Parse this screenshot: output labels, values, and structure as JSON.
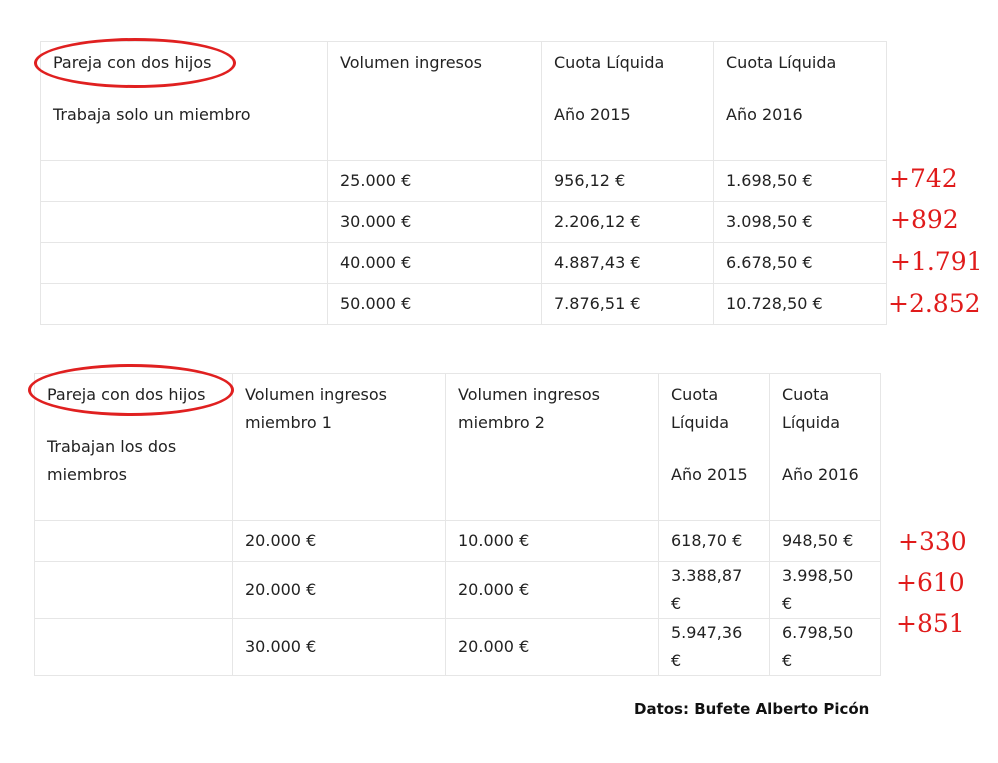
{
  "table1": {
    "header": {
      "title": "Pareja con dos hijos",
      "subtitle": "Trabaja solo un miembro",
      "income": "Volumen ingresos",
      "quota_label_2015": "Cuota Líquida",
      "year_2015": "Año 2015",
      "quota_label_2016": "Cuota Líquida",
      "year_2016": "Año 2016"
    },
    "rows": [
      {
        "income": "25.000 €",
        "q2015": "956,12 €",
        "q2016": "1.698,50 €",
        "delta": "+742"
      },
      {
        "income": "30.000 €",
        "q2015": "2.206,12 €",
        "q2016": "3.098,50 €",
        "delta": "+892"
      },
      {
        "income": "40.000 €",
        "q2015": "4.887,43 €",
        "q2016": "6.678,50 €",
        "delta": "+1.791"
      },
      {
        "income": "50.000 €",
        "q2015": "7.876,51 €",
        "q2016": "10.728,50 €",
        "delta": "+2.852"
      }
    ]
  },
  "table2": {
    "header": {
      "title": "Pareja con dos hijos",
      "subtitle_1": "Trabajan los dos",
      "subtitle_2": "miembros",
      "income1_a": "Volumen ingresos",
      "income1_b": "miembro 1",
      "income2_a": "Volumen ingresos",
      "income2_b": "miembro 2",
      "q2015_a": "Cuota",
      "q2015_b": "Líquida",
      "year_2015": "Año 2015",
      "q2016_a": "Cuota",
      "q2016_b": "Líquida",
      "year_2016": "Año 2016"
    },
    "rows": [
      {
        "income1": "20.000 €",
        "income2": "10.000 €",
        "q2015": "618,70 €",
        "q2016": "948,50 €",
        "delta": "+330"
      },
      {
        "income1": "20.000 €",
        "income2": "20.000 €",
        "q2015": "3.388,87 €",
        "q2016": "3.998,50 €",
        "delta": "+610"
      },
      {
        "income1": "30.000 €",
        "income2": "20.000 €",
        "q2015": "5.947,36 €",
        "q2016": "6.798,50 €",
        "delta": "+851"
      }
    ]
  },
  "source": "Datos: Bufete Alberto Picón",
  "colors": {
    "annotation": "#e01b1b",
    "border": "#e6e6e6",
    "text": "#222222"
  }
}
